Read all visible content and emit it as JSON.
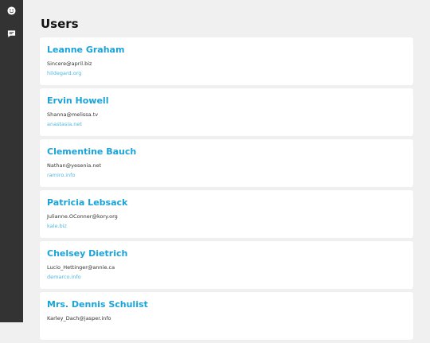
{
  "sidebar": {
    "icons": [
      "smiley-icon",
      "message-icon"
    ]
  },
  "main": {
    "title": "Users",
    "users": [
      {
        "name": "Leanne Graham",
        "email": "Sincere@april.biz",
        "website": "hildegard.org"
      },
      {
        "name": "Ervin Howell",
        "email": "Shanna@melissa.tv",
        "website": "anastasia.net"
      },
      {
        "name": "Clementine Bauch",
        "email": "Nathan@yesenia.net",
        "website": "ramiro.info"
      },
      {
        "name": "Patricia Lebsack",
        "email": "Julianne.OConner@kory.org",
        "website": "kale.biz"
      },
      {
        "name": "Chelsey Dietrich",
        "email": "Lucio_Hettinger@annie.ca",
        "website": "demarco.info"
      },
      {
        "name": "Mrs. Dennis Schulist",
        "email": "Karley_Dach@jasper.info",
        "website": ""
      }
    ]
  },
  "colors": {
    "sidebar_bg": "#333333",
    "page_bg": "#f0f0f0",
    "name_accent": "#1aa3d9",
    "link": "#4fb7e0"
  }
}
